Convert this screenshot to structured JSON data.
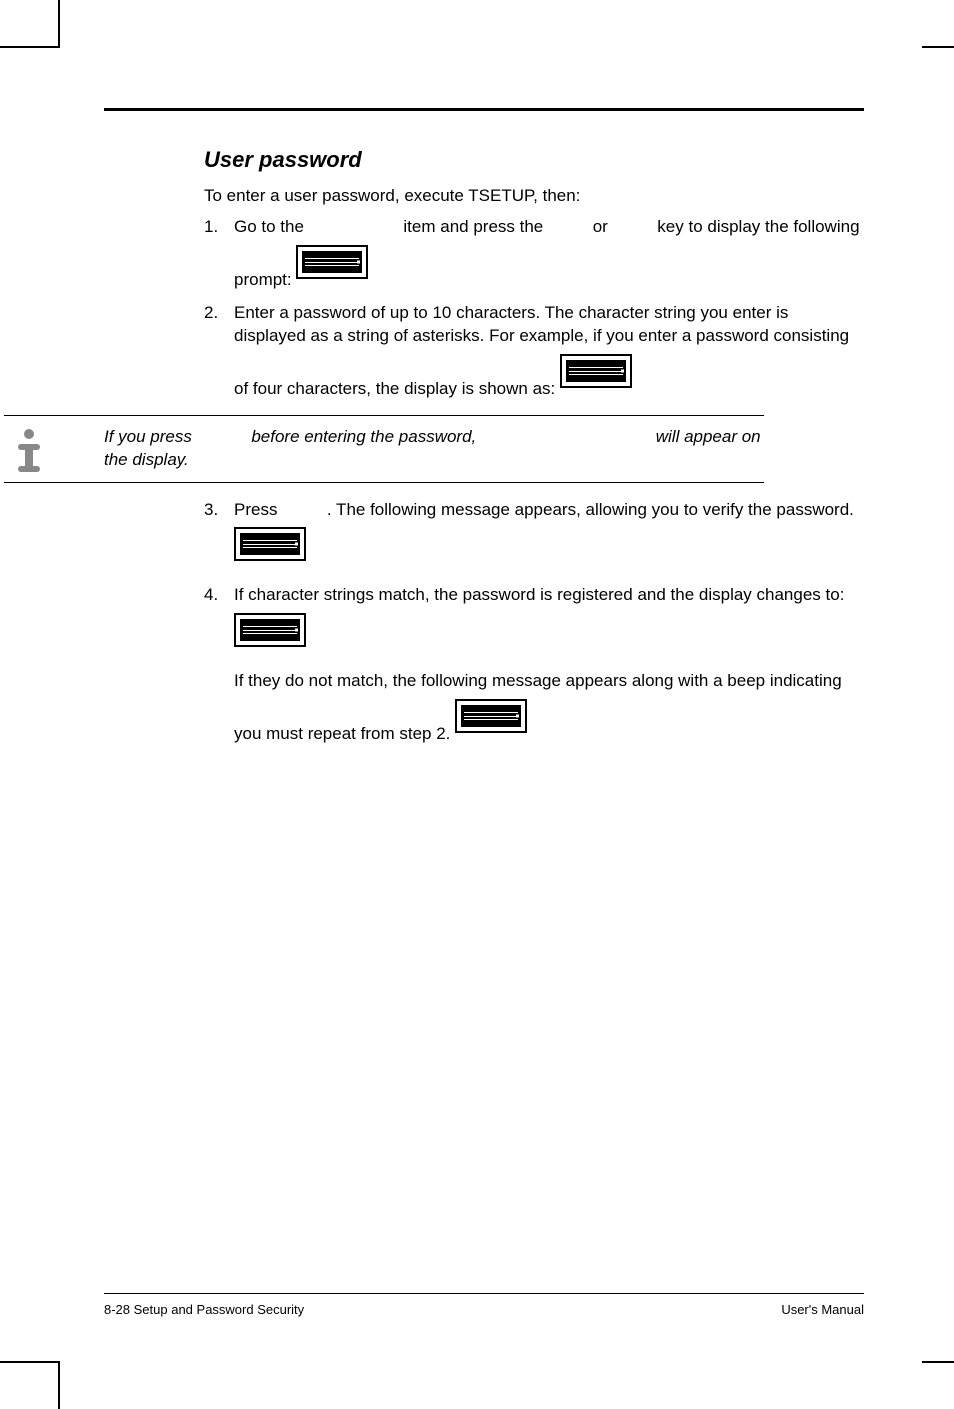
{
  "section_title": "User password",
  "intro": "To enter a user password, execute TSETUP, then:",
  "steps": {
    "s1": {
      "num": "1.",
      "t1": "Go to the ",
      "t2": " item and press the ",
      "t3": " or ",
      "t4": " key to display the following prompt:"
    },
    "s2": {
      "num": "2.",
      "text": "Enter a password of up to 10 characters. The character string you enter is displayed as a string of asterisks. For example, if you enter a password consisting of four characters, the display is shown as:"
    },
    "s3": {
      "num": "3.",
      "t1": "Press ",
      "t2": ". The following message appears, allowing you to verify the password."
    },
    "s4": {
      "num": "4.",
      "text": "If character strings match, the password is registered and the display changes to:",
      "tail": "If they do not match, the following message appears along with a beep indicating you must repeat from step 2."
    }
  },
  "note": {
    "t1": "If you press ",
    "t2": " before entering the password, ",
    "t3": " will appear on the display."
  },
  "footer": {
    "left": "8-28  Setup and Password Security",
    "right": "User's Manual"
  }
}
